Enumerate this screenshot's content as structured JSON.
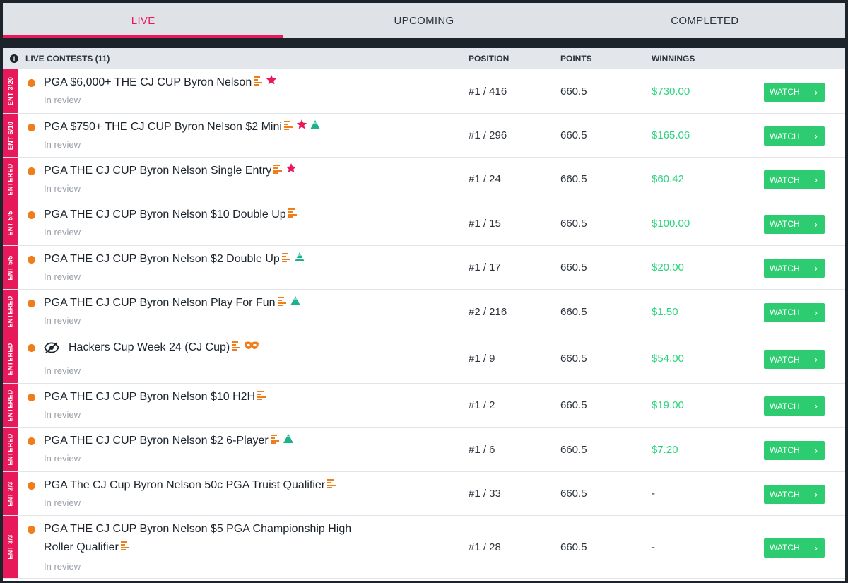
{
  "tabs": [
    {
      "label": "LIVE",
      "active": true
    },
    {
      "label": "UPCOMING",
      "active": false
    },
    {
      "label": "COMPLETED",
      "active": false
    }
  ],
  "header": {
    "title": "LIVE CONTESTS (11)",
    "position": "POSITION",
    "points": "POINTS",
    "winnings": "WINNINGS"
  },
  "watch_label": "WATCH",
  "colors": {
    "accent": "#e8195a",
    "green": "#2ecc71",
    "winnings": "#2dd47f",
    "dot": "#ef7d1a",
    "star": "#e8195a",
    "pyramid": "#1bb38c"
  },
  "rows": [
    {
      "tag": "ENT 3/20",
      "name": "PGA $6,000+ THE CJ CUP Byron Nelson",
      "status": "In review",
      "position": "#1 / 416",
      "points": "660.5",
      "winnings": "$730.00",
      "icons": [
        "bars-icon",
        "star-icon"
      ]
    },
    {
      "tag": "ENT 6/10",
      "name": "PGA $750+ THE CJ CUP Byron Nelson $2 Mini",
      "status": "In review",
      "position": "#1 / 296",
      "points": "660.5",
      "winnings": "$165.06",
      "icons": [
        "bars-icon",
        "star-icon",
        "pyramid-icon"
      ]
    },
    {
      "tag": "ENTERED",
      "name": "PGA THE CJ CUP Byron Nelson Single Entry",
      "status": "In review",
      "position": "#1 / 24",
      "points": "660.5",
      "winnings": "$60.42",
      "icons": [
        "bars-icon",
        "star-icon"
      ]
    },
    {
      "tag": "ENT 5/5",
      "name": "PGA THE CJ CUP Byron Nelson $10 Double Up",
      "status": "In review",
      "position": "#1 / 15",
      "points": "660.5",
      "winnings": "$100.00",
      "icons": [
        "bars-icon"
      ]
    },
    {
      "tag": "ENT 5/5",
      "name": "PGA THE CJ CUP Byron Nelson $2 Double Up",
      "status": "In review",
      "position": "#1 / 17",
      "points": "660.5",
      "winnings": "$20.00",
      "icons": [
        "bars-icon",
        "pyramid-icon"
      ]
    },
    {
      "tag": "ENTERED",
      "name": "PGA THE CJ CUP Byron Nelson Play For Fun",
      "status": "In review",
      "position": "#2 / 216",
      "points": "660.5",
      "winnings": "$1.50",
      "icons": [
        "bars-icon",
        "pyramid-icon"
      ]
    },
    {
      "tag": "ENTERED",
      "name": "Hackers Cup Week 24 (CJ Cup)",
      "status": "In review",
      "position": "#1 / 9",
      "points": "660.5",
      "winnings": "$54.00",
      "icons": [
        "bars-icon",
        "mask-icon"
      ],
      "private": true
    },
    {
      "tag": "ENTERED",
      "name": "PGA THE CJ CUP Byron Nelson $10 H2H",
      "status": "In review",
      "position": "#1 / 2",
      "points": "660.5",
      "winnings": "$19.00",
      "icons": [
        "bars-icon"
      ]
    },
    {
      "tag": "ENTERED",
      "name": "PGA THE CJ CUP Byron Nelson $2 6-Player",
      "status": "In review",
      "position": "#1 / 6",
      "points": "660.5",
      "winnings": "$7.20",
      "icons": [
        "bars-icon",
        "pyramid-icon"
      ]
    },
    {
      "tag": "ENT 2/3",
      "name": "PGA The CJ Cup Byron Nelson 50c PGA Truist Qualifier",
      "status": "In review",
      "position": "#1 / 33",
      "points": "660.5",
      "winnings": "-",
      "icons": [
        "bars-icon"
      ]
    },
    {
      "tag": "ENT 3/3",
      "name": "PGA THE CJ CUP Byron Nelson $5 PGA Championship High Roller Qualifier",
      "status": "In review",
      "position": "#1 / 28",
      "points": "660.5",
      "winnings": "-",
      "icons": [
        "bars-icon"
      ],
      "wrap": true
    }
  ]
}
